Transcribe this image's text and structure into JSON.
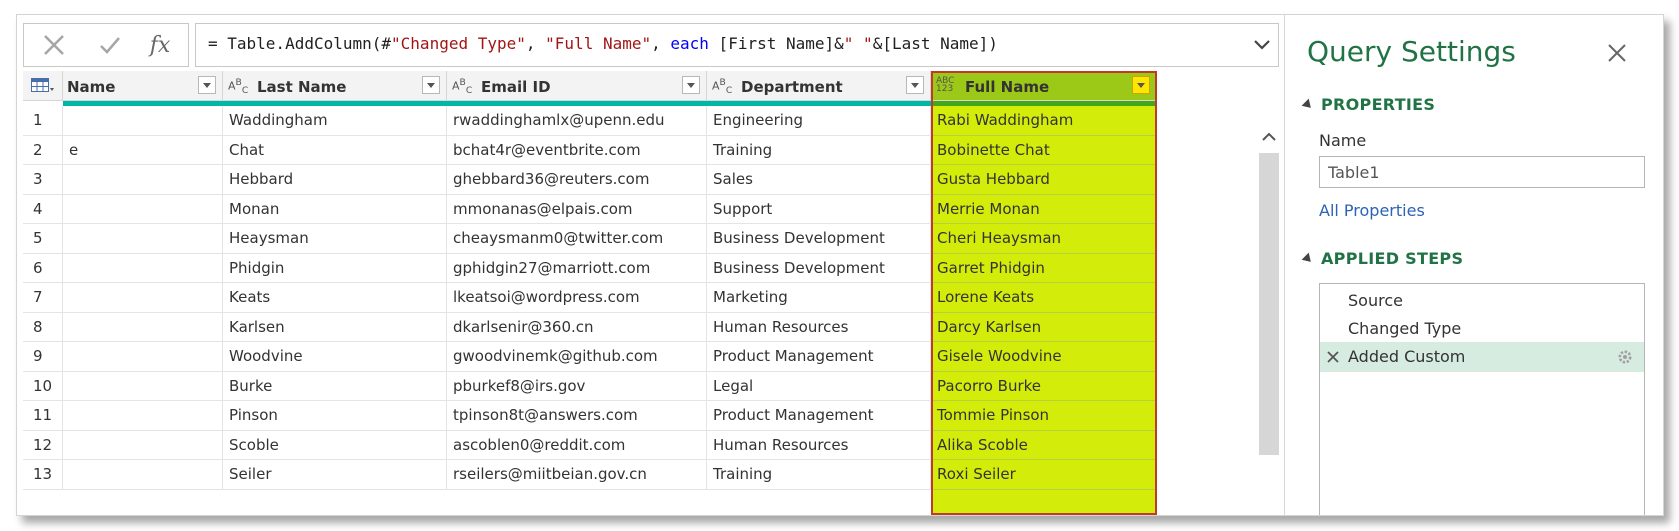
{
  "formula_bar": {
    "cancel_icon": "close-x-icon",
    "commit_icon": "check-icon",
    "fx_label": "fx",
    "formula": {
      "p1": "= Table.AddColumn(#",
      "p2": "\"Changed Type\"",
      "p3": ", ",
      "p4": "\"Full Name\"",
      "p5": ", ",
      "p6": "each",
      "p7": " [First Name]&",
      "p8": "\" \"",
      "p9": "&[Last Name])"
    }
  },
  "grid": {
    "columns": [
      {
        "label": "Name",
        "type": ""
      },
      {
        "label": "Last Name",
        "type": "ABC"
      },
      {
        "label": "Email ID",
        "type": "ABC"
      },
      {
        "label": "Department",
        "type": "ABC"
      },
      {
        "label": "Full Name",
        "type": "ABC123"
      }
    ],
    "rows": [
      {
        "n": "1",
        "first": "",
        "last": "Waddingham",
        "email": "rwaddinghamlx@upenn.edu",
        "dept": "Engineering",
        "full": "Rabi Waddingham"
      },
      {
        "n": "2",
        "first": "e",
        "last": "Chat",
        "email": "bchat4r@eventbrite.com",
        "dept": "Training",
        "full": "Bobinette Chat"
      },
      {
        "n": "3",
        "first": "",
        "last": "Hebbard",
        "email": "ghebbard36@reuters.com",
        "dept": "Sales",
        "full": "Gusta Hebbard"
      },
      {
        "n": "4",
        "first": "",
        "last": "Monan",
        "email": "mmonanas@elpais.com",
        "dept": "Support",
        "full": "Merrie Monan"
      },
      {
        "n": "5",
        "first": "",
        "last": "Heaysman",
        "email": "cheaysmanm0@twitter.com",
        "dept": "Business Development",
        "full": "Cheri Heaysman"
      },
      {
        "n": "6",
        "first": "",
        "last": "Phidgin",
        "email": "gphidgin27@marriott.com",
        "dept": "Business Development",
        "full": "Garret Phidgin"
      },
      {
        "n": "7",
        "first": "",
        "last": "Keats",
        "email": "lkeatsoi@wordpress.com",
        "dept": "Marketing",
        "full": "Lorene Keats"
      },
      {
        "n": "8",
        "first": "",
        "last": "Karlsen",
        "email": "dkarlsenir@360.cn",
        "dept": "Human Resources",
        "full": "Darcy Karlsen"
      },
      {
        "n": "9",
        "first": "",
        "last": "Woodvine",
        "email": "gwoodvinemk@github.com",
        "dept": "Product Management",
        "full": "Gisele Woodvine"
      },
      {
        "n": "10",
        "first": "",
        "last": "Burke",
        "email": "pburkef8@irs.gov",
        "dept": "Legal",
        "full": "Pacorro Burke"
      },
      {
        "n": "11",
        "first": "",
        "last": "Pinson",
        "email": "tpinson8t@answers.com",
        "dept": "Product Management",
        "full": "Tommie Pinson"
      },
      {
        "n": "12",
        "first": "",
        "last": "Scoble",
        "email": "ascoblen0@reddit.com",
        "dept": "Human Resources",
        "full": "Alika Scoble"
      },
      {
        "n": "13",
        "first": "",
        "last": "Seiler",
        "email": "rseilers@miitbeian.gov.cn",
        "dept": "Training",
        "full": "Roxi Seiler"
      }
    ]
  },
  "query_settings": {
    "title": "Query Settings",
    "properties_heading": "PROPERTIES",
    "name_label": "Name",
    "name_value": "Table1",
    "all_properties": "All Properties",
    "applied_steps_heading": "APPLIED STEPS",
    "steps": [
      "Source",
      "Changed Type",
      "Added Custom"
    ]
  },
  "colors": {
    "accent_green": "#217346",
    "teal_bar": "#00b6a6",
    "selected_column": "#d4ec0a",
    "selected_outline": "#c0392b"
  }
}
